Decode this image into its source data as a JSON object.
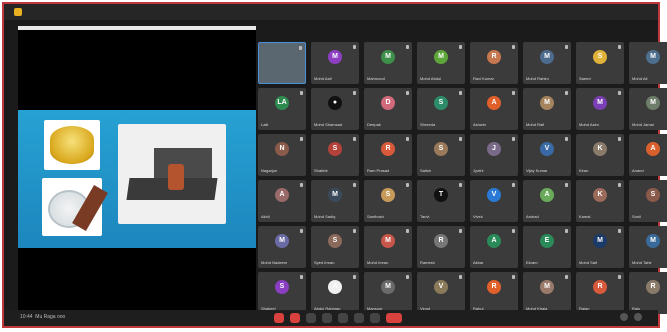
{
  "meeting": {
    "time": "10:44",
    "meeting_label": "Mu Raga ooo"
  },
  "participants": [
    {
      "name": "",
      "initial": "",
      "color": "#5b6770"
    },
    {
      "name": "Mohd Asif",
      "initial": "M",
      "color": "#8f3fc2"
    },
    {
      "name": "Mahmood",
      "initial": "M",
      "color": "#3d8f4a"
    },
    {
      "name": "Mohd Abdul",
      "initial": "M",
      "color": "#5ea53a"
    },
    {
      "name": "Ravi Kumar",
      "initial": "R",
      "color": "#c7774f"
    },
    {
      "name": "Mohd Rahim",
      "initial": "M",
      "color": "#4d6a8f"
    },
    {
      "name": "Saeed",
      "initial": "S",
      "color": "#e0b23a"
    },
    {
      "name": "Mohd Ali",
      "initial": "M",
      "color": "#4e6e8e"
    },
    {
      "name": "Lalit",
      "initial": "LA",
      "color": "#2f8a4f"
    },
    {
      "name": "Mohd Shamsad",
      "initial": "●",
      "color": "#111111"
    },
    {
      "name": "Deepak",
      "initial": "D",
      "color": "#d06a7a"
    },
    {
      "name": "Shreeda",
      "initial": "S",
      "color": "#2c8c6a"
    },
    {
      "name": "Ashwin",
      "initial": "A",
      "color": "#e0602c"
    },
    {
      "name": "Mohd Rafi",
      "initial": "M",
      "color": "#a5835d"
    },
    {
      "name": "Mohd Asim",
      "initial": "M",
      "color": "#7a3fb5"
    },
    {
      "name": "Mohd Jamal",
      "initial": "M",
      "color": "#6d7d6a"
    },
    {
      "name": "Nagarjun",
      "initial": "N",
      "color": "#8a5a4a"
    },
    {
      "name": "Shabbir",
      "initial": "S",
      "color": "#b3423a"
    },
    {
      "name": "Ram Prasad",
      "initial": "R",
      "color": "#d85a3a"
    },
    {
      "name": "Satish",
      "initial": "S",
      "color": "#9a7a5a"
    },
    {
      "name": "Jyothi",
      "initial": "J",
      "color": "#7a6a8a"
    },
    {
      "name": "Vijay Kumar",
      "initial": "V",
      "color": "#3a6aa5"
    },
    {
      "name": "Kiran",
      "initial": "K",
      "color": "#8a7a6a"
    },
    {
      "name": "Anand",
      "initial": "A",
      "color": "#d8602c"
    },
    {
      "name": "Akhil",
      "initial": "A",
      "color": "#9a6a6a"
    },
    {
      "name": "Mohd Sadiq",
      "initial": "M",
      "color": "#3a4a5a"
    },
    {
      "name": "Santhosh",
      "initial": "S",
      "color": "#c79a5a"
    },
    {
      "name": "Tanvi",
      "initial": "T",
      "color": "#111111"
    },
    {
      "name": "Vivek",
      "initial": "V",
      "color": "#2a7ad5"
    },
    {
      "name": "Arshad",
      "initial": "A",
      "color": "#6aaa5a"
    },
    {
      "name": "Kamal",
      "initial": "K",
      "color": "#9a6a5a"
    },
    {
      "name": "Sunil",
      "initial": "S",
      "color": "#8a5a4a"
    },
    {
      "name": "Mohd Nadeem",
      "initial": "M",
      "color": "#6a6aa5"
    },
    {
      "name": "Syed Imran",
      "initial": "S",
      "color": "#8a6a5a"
    },
    {
      "name": "Mohd Imran",
      "initial": "M",
      "color": "#c7574a"
    },
    {
      "name": "Ramesh",
      "initial": "R",
      "color": "#777777"
    },
    {
      "name": "Akbar",
      "initial": "A",
      "color": "#2a8a5a"
    },
    {
      "name": "Ekram",
      "initial": "E",
      "color": "#2a8a5a"
    },
    {
      "name": "Mohd Saif",
      "initial": "M",
      "color": "#1a3a6a"
    },
    {
      "name": "Mohd Tahir",
      "initial": "M",
      "color": "#3a6a9a"
    },
    {
      "name": "Shakeel",
      "initial": "S",
      "color": "#8a3fc2"
    },
    {
      "name": "Abdul Rahman",
      "initial": "A",
      "color": "#f0f0f0"
    },
    {
      "name": "Mansoor",
      "initial": "M",
      "color": "#6a6a6a"
    },
    {
      "name": "Vinod",
      "initial": "V",
      "color": "#8a7a5a"
    },
    {
      "name": "Rahul",
      "initial": "R",
      "color": "#e0602c"
    },
    {
      "name": "Mohd Khaja",
      "initial": "M",
      "color": "#9a7a6a"
    },
    {
      "name": "Rajan",
      "initial": "R",
      "color": "#d85a3a"
    },
    {
      "name": "Raju",
      "initial": "R",
      "color": "#8a7a6a"
    }
  ]
}
